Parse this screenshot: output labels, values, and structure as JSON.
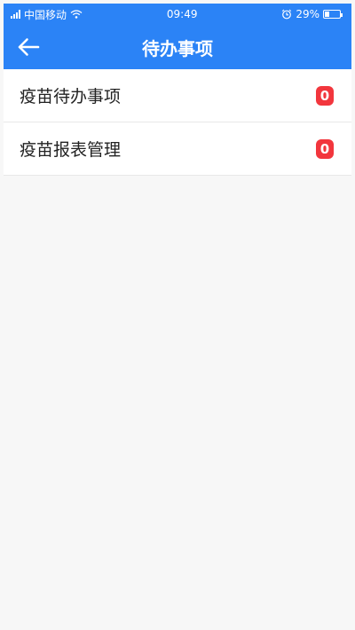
{
  "status_bar": {
    "carrier": "中国移动",
    "time": "09:49",
    "battery_percent": "29%",
    "battery_level": 0.29,
    "icons": [
      "signal-icon",
      "wifi-icon",
      "alarm-icon",
      "battery-icon"
    ]
  },
  "header": {
    "title": "待办事项",
    "back_icon": "arrow-left-icon"
  },
  "list": {
    "items": [
      {
        "label": "疫苗待办事项",
        "count": "0"
      },
      {
        "label": "疫苗报表管理",
        "count": "0"
      }
    ]
  },
  "colors": {
    "header_bg": "#2b83f6",
    "badge_bg": "#f2363d",
    "page_bg": "#f7f7f7"
  }
}
